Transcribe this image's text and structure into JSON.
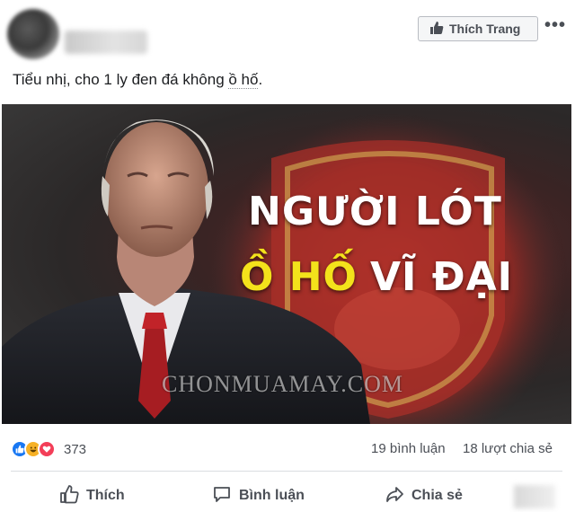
{
  "header": {
    "like_page_label": "Thích Trang",
    "more_label": "•••"
  },
  "post": {
    "caption_before": "Tiểu nhị, cho 1 ly đen đá không ",
    "caption_underlined": "ồ hố",
    "caption_after": "."
  },
  "image": {
    "headline_line1": "NGƯỜI LÓT",
    "headline_line2_highlight": "Ồ HỐ",
    "headline_line2_rest": "VĨ ĐẠI",
    "watermark": "CHONMUAMAY.COM",
    "highlight_color": "#f3e21b"
  },
  "stats": {
    "reactions": [
      "like-icon",
      "haha-icon",
      "love-icon"
    ],
    "reaction_count": "373",
    "comments": "19 bình luận",
    "shares": "18 lượt chia sẻ"
  },
  "actions": {
    "like_label": "Thích",
    "comment_label": "Bình luận",
    "share_label": "Chia sẻ"
  },
  "colors": {
    "facebook_blue": "#1877f2",
    "text_secondary": "#4b4f56"
  }
}
